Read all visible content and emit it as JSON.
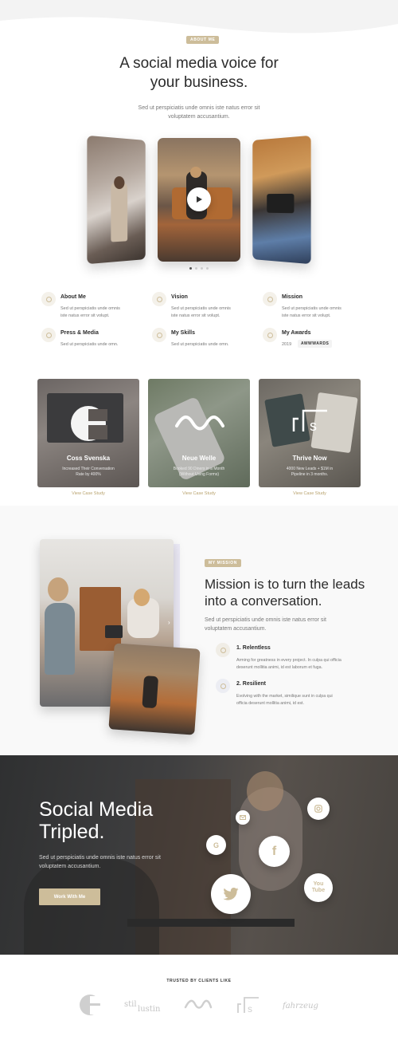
{
  "about": {
    "badge": "ABOUT ME",
    "title_line1": "A social media voice for",
    "title_line2": "your business.",
    "subtitle_line1": "Sed ut perspiciatis unde omnis iste natus error sit",
    "subtitle_line2": "voluptatem accusantium."
  },
  "features": [
    {
      "title": "About Me",
      "text_line1": "Sed ut perspiciatis unde omnis",
      "text_line2": "iste natus error sit volupt."
    },
    {
      "title": "Vision",
      "text_line1": "Sed ut perspiciatis unde omnis",
      "text_line2": "iste natus error sit volupt."
    },
    {
      "title": "Mission",
      "text_line1": "Sed ut perspiciatis unde omnis",
      "text_line2": "iste natus error sit volupt."
    },
    {
      "title": "Press & Media",
      "text_line1": "Sed ut perspiciatis unde omn.",
      "text_line2": ""
    },
    {
      "title": "My Skills",
      "text_line1": "Sed ut perspiciatis unde omn.",
      "text_line2": ""
    },
    {
      "title": "My Awards",
      "year": "2019",
      "award": "AWWWARDS"
    }
  ],
  "cases": [
    {
      "title": "Coss Svenska",
      "text_line1": "Increased Their Conversation",
      "text_line2": "Rate by 400%",
      "link": "View Case Study"
    },
    {
      "title": "Neue Welle",
      "text_line1": "Booked 90 Diners in a Month",
      "text_line2": "(Without Using Forms)",
      "link": "View Case Study"
    },
    {
      "title": "Thrive Now",
      "text_line1": "4000 New Leads + $1M in",
      "text_line2": "Pipeline in 3 months.",
      "link": "View Case Study"
    }
  ],
  "mission": {
    "badge": "MY MISSION",
    "title_line1": "Mission is to turn the leads",
    "title_line2": "into a conversation.",
    "text_line1": "Sed ut perspiciatis unde omnis iste natus error sit",
    "text_line2": "voluptatem accusantium.",
    "items": [
      {
        "title": "1. Relentless",
        "text_line1": "Arming for greatness in every project. In culpa qui officia",
        "text_line2": "deserunt mollitia animi, id est laborum et fuga."
      },
      {
        "title": "2. Resilient",
        "text_line1": "Evolving with the market, similique sunt in culpa qui",
        "text_line2": "officia deserunt mollitia animi, id est."
      }
    ]
  },
  "social": {
    "title_line1": "Social Media",
    "title_line2": "Tripled.",
    "text_line1": "Sed ut perspiciatis unde omnis iste natus error sit",
    "text_line2": "voluptatem accusantium.",
    "button": "Work With Me"
  },
  "trusted": {
    "label": "TRUSTED BY CLIENTS LIKE"
  },
  "colors": {
    "accent": "#cdbd9a",
    "dark": "#3a3a3a"
  }
}
